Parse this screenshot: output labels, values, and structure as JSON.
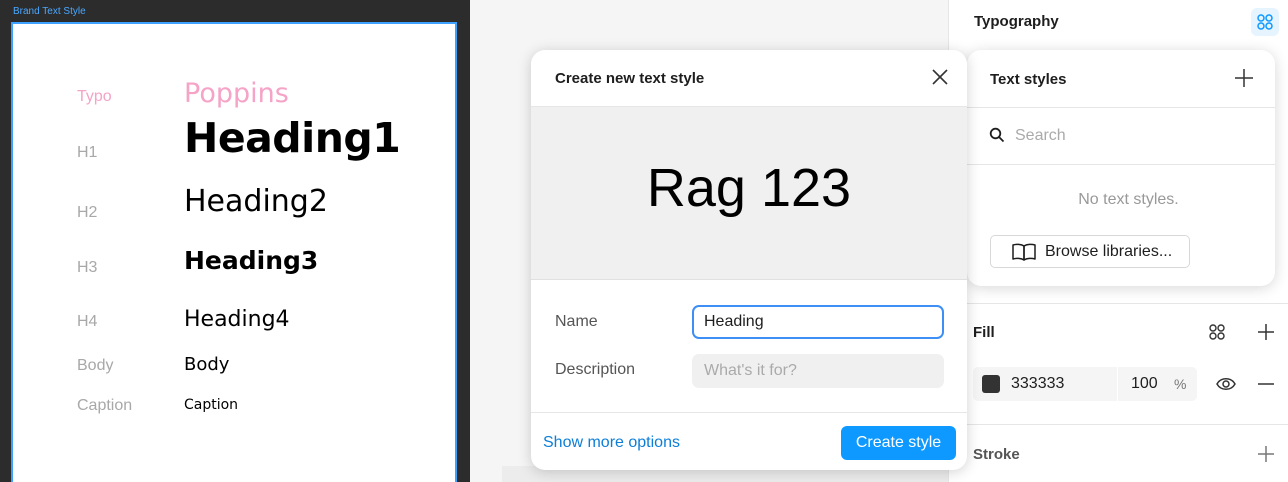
{
  "canvas": {
    "frame_label": "Brand Text Style",
    "rows": {
      "typo": {
        "label": "Typo",
        "value": "Poppins"
      },
      "h1": {
        "label": "H1",
        "sample": "Heading1"
      },
      "h2": {
        "label": "H2",
        "sample": "Heading2"
      },
      "h3": {
        "label": "H3",
        "sample": "Heading3"
      },
      "h4": {
        "label": "H4",
        "sample": "Heading4"
      },
      "body": {
        "label": "Body",
        "sample": "Body"
      },
      "caption": {
        "label": "Caption",
        "sample": "Caption"
      }
    }
  },
  "modal": {
    "title": "Create new text style",
    "preview_text": "Rag 123",
    "name_label": "Name",
    "name_value": "Heading",
    "description_label": "Description",
    "description_placeholder": "What's it for?",
    "more_options_label": "Show more options",
    "create_label": "Create style"
  },
  "panel": {
    "typography_title": "Typography",
    "fill": {
      "title": "Fill",
      "hex": "333333",
      "opacity": "100",
      "percent": "%",
      "swatch_color": "#333333"
    },
    "stroke_title": "Stroke"
  },
  "styles_popover": {
    "title": "Text styles",
    "search_placeholder": "Search",
    "empty_text": "No text styles.",
    "browse_label": "Browse libraries..."
  },
  "colors": {
    "accent": "#0d99ff",
    "selection": "#3ea0ff",
    "pink_label": "#f5a3c7"
  }
}
